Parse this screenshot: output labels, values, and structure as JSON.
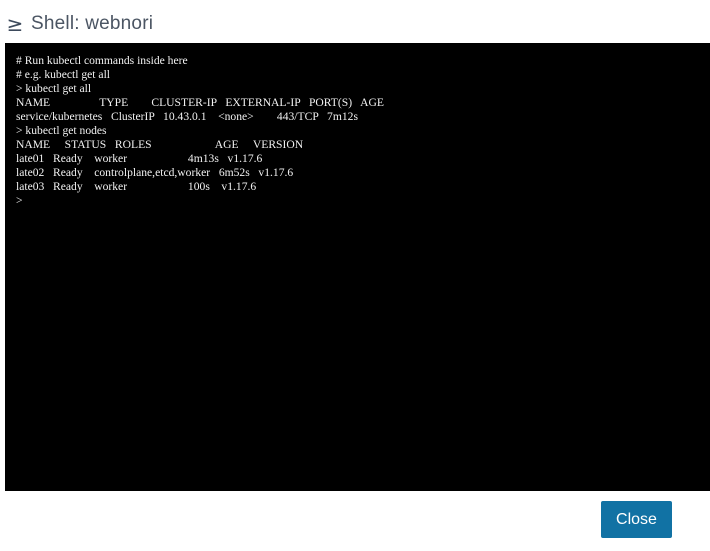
{
  "header": {
    "icon": "shell-icon",
    "title": "Shell: webnori"
  },
  "terminal": {
    "lines": [
      "# Run kubectl commands inside here",
      "# e.g. kubectl get all",
      "> kubectl get all",
      "NAME                 TYPE        CLUSTER-IP   EXTERNAL-IP   PORT(S)   AGE",
      "service/kubernetes   ClusterIP   10.43.0.1    <none>        443/TCP   7m12s",
      "> kubectl get nodes",
      "NAME     STATUS   ROLES                      AGE     VERSION",
      "late01   Ready    worker                     4m13s   v1.17.6",
      "late02   Ready    controlplane,etcd,worker   6m52s   v1.17.6",
      "late03   Ready    worker                     100s    v1.17.6",
      ">"
    ]
  },
  "footer": {
    "close_label": "Close"
  },
  "colors": {
    "terminal_background": "#000000",
    "terminal_text": "#f2f2f2",
    "button_background": "#1172a4",
    "title_text": "#4b5563"
  }
}
